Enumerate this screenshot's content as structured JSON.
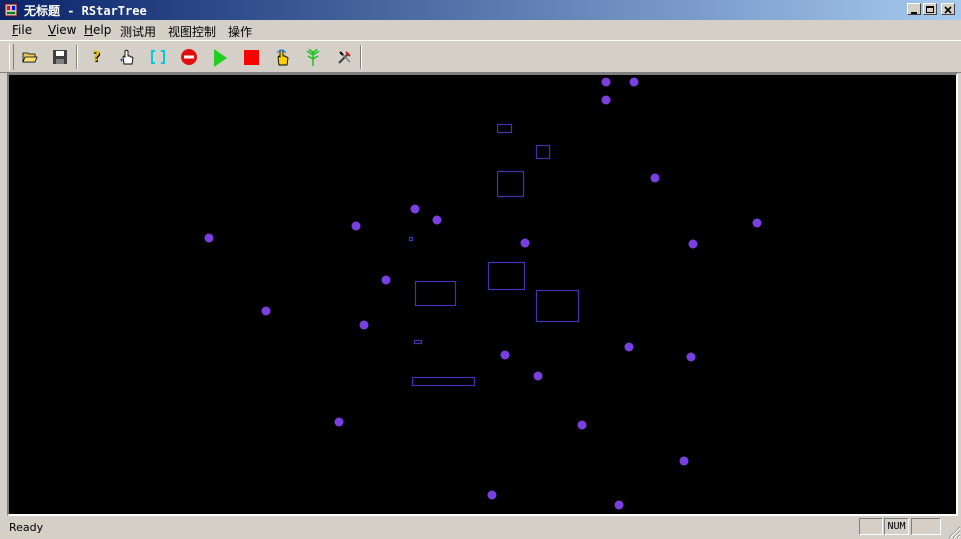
{
  "window": {
    "title": "无标题 - RStarTree"
  },
  "menu": [
    {
      "label": "File",
      "mnemonic": "F",
      "rest": "ile"
    },
    {
      "label": "View",
      "mnemonic": "V",
      "rest": "iew"
    },
    {
      "label": "Help",
      "mnemonic": "H",
      "rest": "elp"
    },
    {
      "label": "测试用"
    },
    {
      "label": "视图控制"
    },
    {
      "label": "操作"
    }
  ],
  "toolbar": {
    "icons": [
      "open-folder-icon",
      "save-disk-icon",
      "help-icon",
      "hand-pointer-icon",
      "select-bracket-icon",
      "stop-sign-icon",
      "play-icon",
      "stop-square-icon",
      "touch-hand-icon",
      "tree-icon",
      "tools-icon"
    ]
  },
  "canvas": {
    "background": "#000000",
    "point_color": "#7a3fe0",
    "rect_color": "#4a2fb0"
  },
  "status": {
    "text": "Ready",
    "num": "NUM"
  }
}
